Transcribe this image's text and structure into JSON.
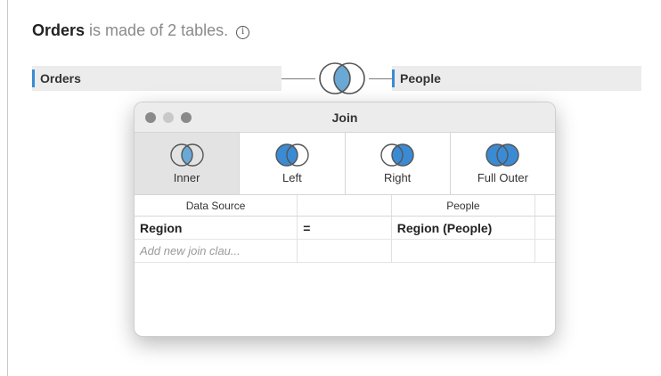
{
  "header": {
    "datasource_name": "Orders",
    "description": "is made of 2 tables.",
    "info_icon": "info-icon"
  },
  "canvas": {
    "left_table": "Orders",
    "right_table": "People",
    "join_icon": "inner-join-venn-icon"
  },
  "dialog": {
    "title": "Join",
    "window_controls": [
      "close",
      "minimize",
      "maximize"
    ],
    "join_types": [
      {
        "label": "Inner",
        "icon": "inner-join-icon",
        "selected": true
      },
      {
        "label": "Left",
        "icon": "left-join-icon",
        "selected": false
      },
      {
        "label": "Right",
        "icon": "right-join-icon",
        "selected": false
      },
      {
        "label": "Full Outer",
        "icon": "full-outer-join-icon",
        "selected": false
      }
    ],
    "columns": {
      "left": "Data Source",
      "right": "People"
    },
    "clauses": [
      {
        "left_field": "Region",
        "operator": "=",
        "right_field": "Region (People)"
      }
    ],
    "add_clause_placeholder": "Add new join clau..."
  },
  "colors": {
    "accent_blue": "#3a8bd4",
    "inner_fill": "#6aa8d6",
    "selected_bg": "#e3e3e3"
  }
}
